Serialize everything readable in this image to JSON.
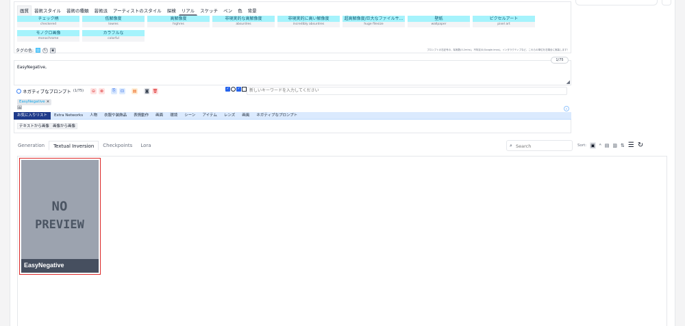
{
  "colors": {
    "accent": "#1e3a8a",
    "tag_bg": "#a5f3fc",
    "card_border": "#dc2626"
  },
  "tag_helper": {
    "categories": [
      "画質",
      "芸術スタイル",
      "芸術の種類",
      "芸術派",
      "アーティストのスタイル",
      "探検",
      "リアル",
      "スケッチ",
      "ペン",
      "色",
      "背景"
    ],
    "tags": [
      {
        "jp": "チェック柄",
        "en": "checkered"
      },
      {
        "jp": "低解像度",
        "en": "lowres"
      },
      {
        "jp": "高解像度",
        "en": "highres"
      },
      {
        "jp": "非現実的な高解像度",
        "en": "absurdres"
      },
      {
        "jp": "非現実的に高い解像度",
        "en": "incredibly absurdres"
      },
      {
        "jp": "超高解像度/巨大なファイルサ...",
        "en": "huge filesize"
      },
      {
        "jp": "壁紙",
        "en": "wallpaper"
      },
      {
        "jp": "ピクセルアート",
        "en": "pixel art"
      },
      {
        "jp": "モノクロ画像",
        "en": "monochrome"
      },
      {
        "jp": "カラフルな",
        "en": "colorful"
      }
    ],
    "color_label": "タグの色:",
    "note": "プロンプトの右記号の、除実数(0.2mhs)、不特定の(Google.imas)、インタラクティブなど、これらの単位を右頭全に実装します！"
  },
  "prompt": {
    "text": "EasyNegative,",
    "token_count": "1/75",
    "resize_glyph": "◢"
  },
  "negative": {
    "label": "ネガティブなプロンプト",
    "count": "(1/75)",
    "keyword_placeholder": "新しいキーワードを入力してください",
    "chip": "EasyNegative",
    "chip_close": "×",
    "chip_icon": "🖼"
  },
  "sub_tabs": [
    "お気に入りリスト",
    "Extra Networks",
    "人物",
    "衣服や装飾品",
    "表情動作",
    "画面",
    "環境",
    "シーン",
    "アイテム",
    "レンズ",
    "画風",
    "ネガティブなプロンプト"
  ],
  "sub2_buttons": [
    "テキストから画像",
    "画像から画像"
  ],
  "networks": {
    "tabs": [
      "Generation",
      "Textual Inversion",
      "Checkpoints",
      "Lora"
    ],
    "active_tab": "Textual Inversion",
    "search_placeholder": "Search",
    "sort_label": "Sort:",
    "cards": [
      {
        "name": "EasyNegative",
        "preview_text_1": "NO",
        "preview_text_2": "PREVIEW"
      }
    ]
  }
}
